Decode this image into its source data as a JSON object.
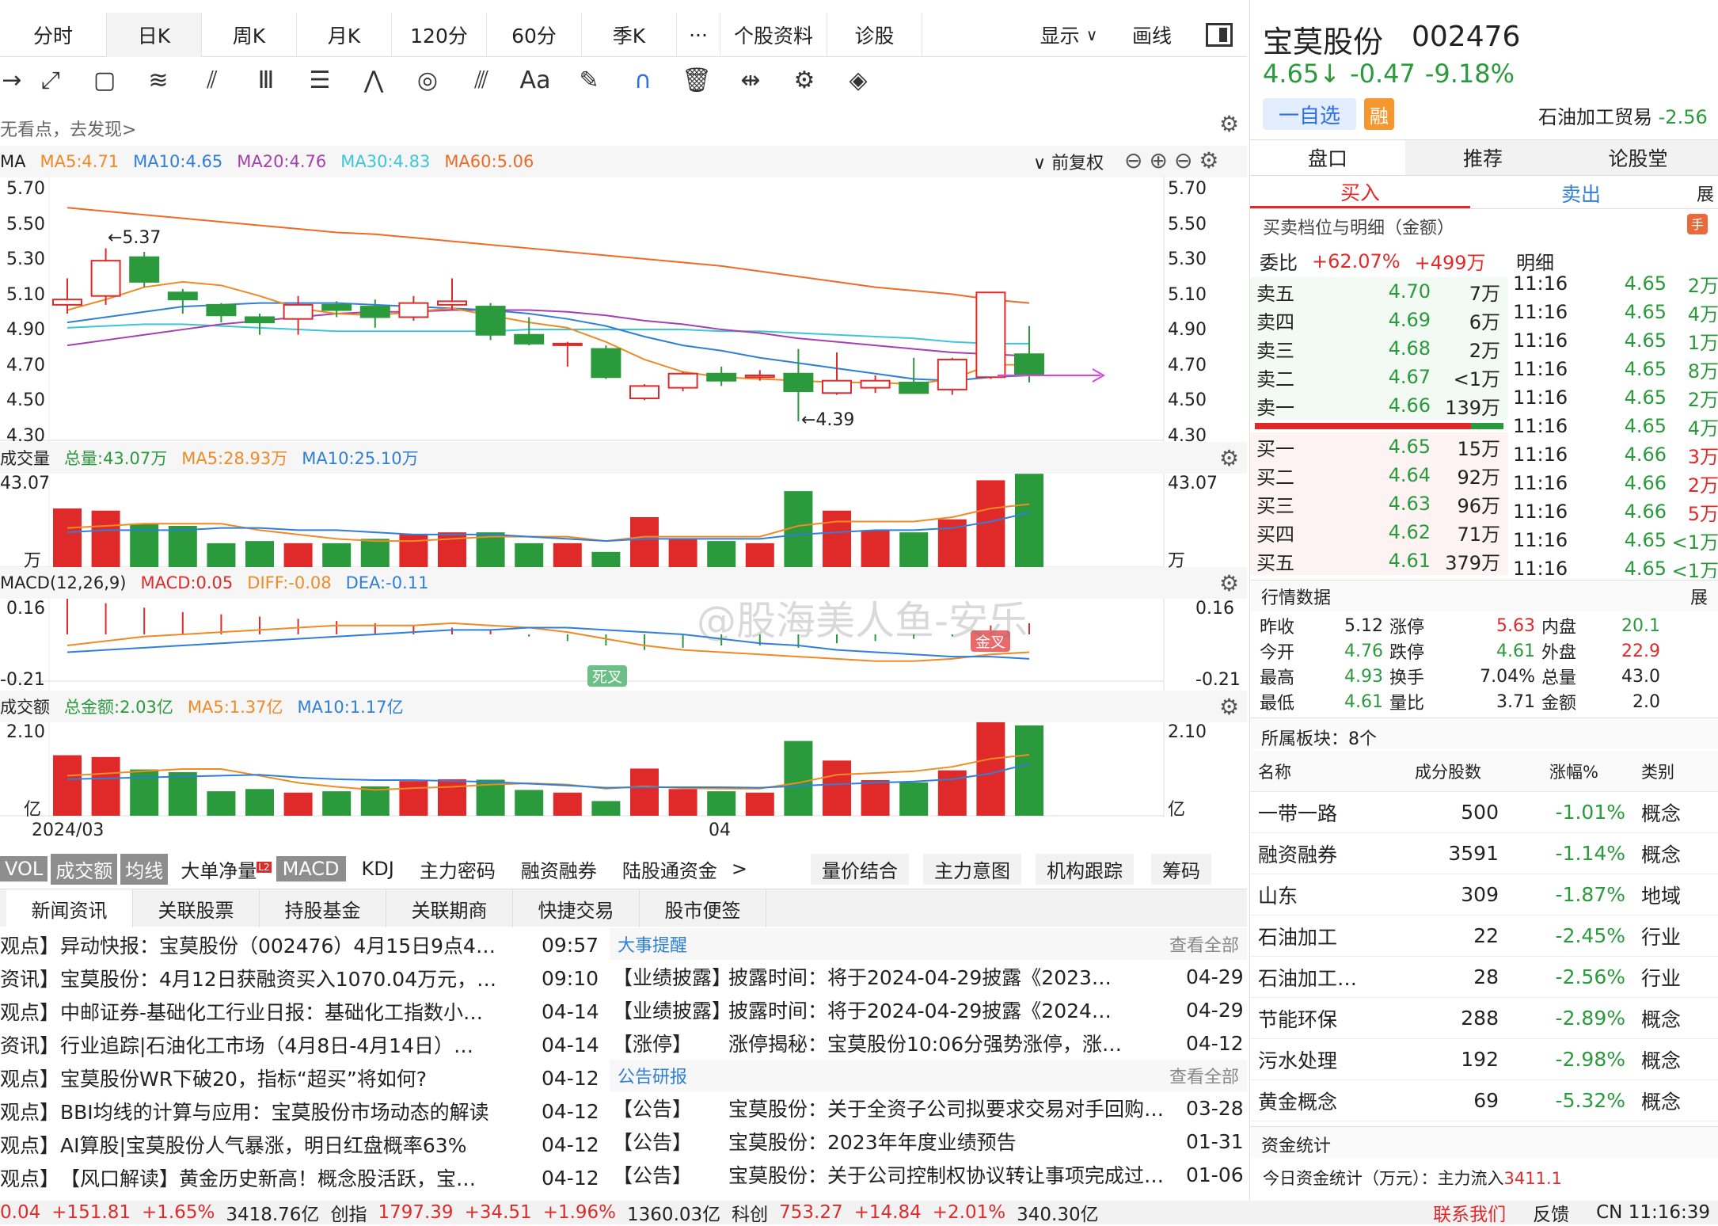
{
  "top_tabs": [
    "分时",
    "日K",
    "周K",
    "月K",
    "120分",
    "60分",
    "季K",
    "···",
    "个股资料",
    "诊股"
  ],
  "top_right": {
    "display": "显示",
    "draw": "画线"
  },
  "tip_text": "无看点，去发现>",
  "ma_bar": {
    "label": "MA",
    "ma5": "MA5:4.71",
    "ma10": "MA10:4.65",
    "ma20": "MA20:4.76",
    "ma30": "MA30:4.83",
    "ma60": "MA60:5.06",
    "adjust": "前复权"
  },
  "price_axis": [
    "5.70",
    "5.50",
    "5.30",
    "5.10",
    "4.90",
    "4.70",
    "4.50",
    "4.30"
  ],
  "high_mark": "←5.37",
  "low_mark": "←4.39",
  "vol_bar": {
    "label": "成交量",
    "total": "总量:43.07万",
    "ma5": "MA5:28.93万",
    "ma10": "MA10:25.10万"
  },
  "vol_axis": {
    "top": "43.07",
    "unit": "万"
  },
  "macd_bar": {
    "label": "MACD(12,26,9)",
    "macd": "MACD:0.05",
    "diff": "DIFF:-0.08",
    "dea": "DEA:-0.11"
  },
  "macd_axis": {
    "top": "0.16",
    "bottom": "-0.21"
  },
  "macd_marks": {
    "dead": "死叉",
    "golden": "金叉"
  },
  "amt_bar": {
    "label": "成交额",
    "total": "总金额:2.03亿",
    "ma5": "MA5:1.37亿",
    "ma10": "MA10:1.17亿"
  },
  "amt_axis": {
    "top": "2.10",
    "unit": "亿"
  },
  "dates": [
    "2024/03",
    "04"
  ],
  "watermark": "@股海美人鱼-安乐",
  "indicator_tabs": [
    "VOL",
    "成交额",
    "均线",
    "大单净量",
    "MACD",
    "KDJ",
    "主力密码",
    "融资融券",
    "陆股通资金",
    ">"
  ],
  "indicator_badge": "L2",
  "right_tabs": [
    "量价结合",
    "主力意图",
    "机构跟踪",
    "筹码"
  ],
  "news_tabs": [
    "新闻资讯",
    "关联股票",
    "持股基金",
    "关联期商",
    "快捷交易",
    "股市便签"
  ],
  "news": [
    {
      "tag": "观点】",
      "title": "异动快报：宝莫股份（002476）4月15日9点4…",
      "time": "09:57"
    },
    {
      "tag": "资讯】",
      "title": "宝莫股份：4月12日获融资买入1070.04万元，…",
      "time": "09:10"
    },
    {
      "tag": "观点】",
      "title": "中邮证券-基础化工行业日报：基础化工指数小…",
      "time": "04-14"
    },
    {
      "tag": "资讯】",
      "title": "行业追踪|石油化工市场（4月8日-4月14日）…",
      "time": "04-14"
    },
    {
      "tag": "观点】",
      "title": "宝莫股份WR下破20，指标“超买”将如何?",
      "time": "04-12"
    },
    {
      "tag": "观点】",
      "title": "BBI均线的计算与应用：宝莫股份市场动态的解读",
      "time": "04-12"
    },
    {
      "tag": "观点】",
      "title": "AI算股|宝莫股份人气暴涨，明日红盘概率63%",
      "time": "04-12"
    },
    {
      "tag": "观点】",
      "title": "【风口解读】黄金历史新高！概念股活跃，宝…",
      "time": "04-12"
    }
  ],
  "events_title": "大事提醒",
  "view_all": "查看全部",
  "events": [
    {
      "tag": "【业绩披露】",
      "title": "披露时间：将于2024-04-29披露《2023…",
      "time": "04-29"
    },
    {
      "tag": "【业绩披露】",
      "title": "披露时间：将于2024-04-29披露《2024…",
      "time": "04-29"
    },
    {
      "tag": "【涨停】",
      "title": "涨停揭秘：宝莫股份10:06分强势涨停，涨…",
      "time": "04-12"
    }
  ],
  "notice_title": "公告研报",
  "notices": [
    {
      "tag": "【公告】",
      "title": "宝莫股份：关于全资子公司拟要求交易对手回购…",
      "time": "03-28"
    },
    {
      "tag": "【公告】",
      "title": "宝莫股份：2023年年度业绩预告",
      "time": "01-31"
    },
    {
      "tag": "【公告】",
      "title": "宝莫股份：关于公司控制权协议转让事项完成过…",
      "time": "01-06"
    }
  ],
  "stock": {
    "name": "宝莫股份",
    "code": "002476",
    "price": "4.65↓",
    "chg": "-0.47",
    "pct": "-9.18%",
    "watch": "一自选",
    "margin": "融",
    "sector": "石油加工贸易",
    "sector_pct": "-2.56"
  },
  "quote_tabs": [
    "盘口",
    "推荐",
    "论股堂"
  ],
  "buy_sell_tabs": [
    "买入",
    "卖出",
    "展"
  ],
  "order_title": "买卖档位与明细（金额）",
  "weibi": {
    "label": "委比",
    "pct": "+62.07%",
    "amt": "+499万",
    "detail": "明细"
  },
  "asks": [
    {
      "l": "卖五",
      "p": "4.70",
      "v": "7万"
    },
    {
      "l": "卖四",
      "p": "4.69",
      "v": "6万"
    },
    {
      "l": "卖三",
      "p": "4.68",
      "v": "2万"
    },
    {
      "l": "卖二",
      "p": "4.67",
      "v": "<1万"
    },
    {
      "l": "卖一",
      "p": "4.66",
      "v": "139万"
    }
  ],
  "bids": [
    {
      "l": "买一",
      "p": "4.65",
      "v": "15万"
    },
    {
      "l": "买二",
      "p": "4.64",
      "v": "92万"
    },
    {
      "l": "买三",
      "p": "4.63",
      "v": "96万"
    },
    {
      "l": "买四",
      "p": "4.62",
      "v": "71万"
    },
    {
      "l": "买五",
      "p": "4.61",
      "v": "379万"
    }
  ],
  "ticks": [
    {
      "t": "11:16",
      "p": "4.65",
      "v": "2万"
    },
    {
      "t": "11:16",
      "p": "4.65",
      "v": "4万"
    },
    {
      "t": "11:16",
      "p": "4.65",
      "v": "1万"
    },
    {
      "t": "11:16",
      "p": "4.65",
      "v": "8万"
    },
    {
      "t": "11:16",
      "p": "4.65",
      "v": "2万"
    },
    {
      "t": "11:16",
      "p": "4.65",
      "v": "4万"
    },
    {
      "t": "11:16",
      "p": "4.66",
      "v": "3万"
    },
    {
      "t": "11:16",
      "p": "4.66",
      "v": "2万"
    },
    {
      "t": "11:16",
      "p": "4.66",
      "v": "5万"
    },
    {
      "t": "11:16",
      "p": "4.65",
      "v": "<1万"
    },
    {
      "t": "11:16",
      "p": "4.65",
      "v": "<1万"
    }
  ],
  "mkt_title": "行情数据",
  "mkt_more": "展",
  "mkt": [
    [
      "昨收",
      "5.12",
      "涨停",
      "5.63",
      "内盘",
      "20.1"
    ],
    [
      "今开",
      "4.76",
      "跌停",
      "4.61",
      "外盘",
      "22.9"
    ],
    [
      "最高",
      "4.93",
      "换手",
      "7.04%",
      "总量",
      "43.0"
    ],
    [
      "最低",
      "4.61",
      "量比",
      "3.71",
      "金额",
      "2.0"
    ]
  ],
  "sector_title": "所属板块：8个",
  "sector_head": [
    "名称",
    "成分股数",
    "涨幅%",
    "类别"
  ],
  "sectors": [
    [
      "一带一路",
      "500",
      "-1.01%",
      "概念"
    ],
    [
      "融资融券",
      "3591",
      "-1.14%",
      "概念"
    ],
    [
      "山东",
      "309",
      "-1.87%",
      "地域"
    ],
    [
      "石油加工",
      "22",
      "-2.45%",
      "行业"
    ],
    [
      "石油加工…",
      "28",
      "-2.56%",
      "行业"
    ],
    [
      "节能环保",
      "288",
      "-2.89%",
      "概念"
    ],
    [
      "污水处理",
      "192",
      "-2.98%",
      "概念"
    ],
    [
      "黄金概念",
      "69",
      "-5.32%",
      "概念"
    ]
  ],
  "fund_title": "资金统计",
  "fund_text": "今日资金统计（万元）：主力流入",
  "fund_val": "3411.1",
  "bottom": {
    "a": "0.04",
    "b": "+151.81",
    "c": "+1.65%",
    "d": "3418.76亿",
    "e": "创指",
    "f": "1797.39",
    "g": "+34.51",
    "h": "+1.96%",
    "i": "1360.03亿",
    "j": "科创",
    "k": "753.27",
    "l": "+14.84",
    "m": "+2.01%",
    "n": "340.30亿",
    "contact": "联系我们",
    "feedback": "反馈",
    "time": "CN 11:16:39"
  },
  "chart_data": {
    "type": "candlestick",
    "ylim": [
      4.3,
      5.7
    ],
    "candles": [
      {
        "o": 5.05,
        "c": 5.08,
        "h": 5.2,
        "l": 5.0
      },
      {
        "o": 5.1,
        "c": 5.3,
        "h": 5.37,
        "l": 5.05
      },
      {
        "o": 5.32,
        "c": 5.18,
        "h": 5.35,
        "l": 5.15
      },
      {
        "o": 5.12,
        "c": 5.08,
        "h": 5.14,
        "l": 5.0
      },
      {
        "o": 5.05,
        "c": 4.99,
        "h": 5.06,
        "l": 4.95
      },
      {
        "o": 4.98,
        "c": 4.95,
        "h": 5.0,
        "l": 4.88
      },
      {
        "o": 4.97,
        "c": 5.05,
        "h": 5.1,
        "l": 4.88
      },
      {
        "o": 5.05,
        "c": 5.02,
        "h": 5.07,
        "l": 4.98
      },
      {
        "o": 5.04,
        "c": 4.98,
        "h": 5.08,
        "l": 4.92
      },
      {
        "o": 4.98,
        "c": 5.06,
        "h": 5.1,
        "l": 4.96
      },
      {
        "o": 5.05,
        "c": 5.07,
        "h": 5.2,
        "l": 5.02
      },
      {
        "o": 5.04,
        "c": 4.88,
        "h": 5.06,
        "l": 4.85
      },
      {
        "o": 4.88,
        "c": 4.83,
        "h": 4.98,
        "l": 4.82
      },
      {
        "o": 4.83,
        "c": 4.83,
        "h": 4.84,
        "l": 4.7
      },
      {
        "o": 4.8,
        "c": 4.64,
        "h": 4.82,
        "l": 4.63
      },
      {
        "o": 4.52,
        "c": 4.59,
        "h": 4.6,
        "l": 4.51
      },
      {
        "o": 4.58,
        "c": 4.66,
        "h": 4.67,
        "l": 4.56
      },
      {
        "o": 4.66,
        "c": 4.62,
        "h": 4.7,
        "l": 4.59
      },
      {
        "o": 4.64,
        "c": 4.65,
        "h": 4.68,
        "l": 4.62
      },
      {
        "o": 4.66,
        "c": 4.56,
        "h": 4.8,
        "l": 4.39
      },
      {
        "o": 4.55,
        "c": 4.62,
        "h": 4.78,
        "l": 4.54
      },
      {
        "o": 4.58,
        "c": 4.62,
        "h": 4.65,
        "l": 4.55
      },
      {
        "o": 4.61,
        "c": 4.55,
        "h": 4.75,
        "l": 4.55
      },
      {
        "o": 4.57,
        "c": 4.74,
        "h": 4.75,
        "l": 4.54
      },
      {
        "o": 4.64,
        "c": 5.12,
        "h": 5.12,
        "l": 4.63
      },
      {
        "o": 4.77,
        "c": 4.65,
        "h": 4.93,
        "l": 4.61
      }
    ],
    "ma5": [
      5.02,
      5.08,
      5.15,
      5.18,
      5.16,
      5.1,
      5.03,
      5.0,
      4.99,
      5.01,
      5.03,
      4.99,
      4.95,
      4.92,
      4.84,
      4.74,
      4.67,
      4.64,
      4.63,
      4.62,
      4.61,
      4.61,
      4.6,
      4.63,
      4.71,
      4.71
    ],
    "ma10": [
      4.95,
      4.98,
      5.01,
      5.04,
      5.05,
      5.06,
      5.06,
      5.06,
      5.05,
      5.04,
      5.03,
      5.02,
      5.0,
      4.97,
      4.93,
      4.87,
      4.82,
      4.79,
      4.75,
      4.72,
      4.69,
      4.66,
      4.63,
      4.62,
      4.64,
      4.65
    ],
    "ma20": [
      4.82,
      4.85,
      4.88,
      4.91,
      4.94,
      4.96,
      4.98,
      5.0,
      5.01,
      5.01,
      5.02,
      5.02,
      5.02,
      5.01,
      4.99,
      4.96,
      4.94,
      4.91,
      4.89,
      4.86,
      4.84,
      4.82,
      4.8,
      4.78,
      4.77,
      4.76
    ],
    "ma30": [
      4.92,
      4.93,
      4.94,
      4.94,
      4.93,
      4.92,
      4.91,
      4.9,
      4.9,
      4.9,
      4.9,
      4.9,
      4.91,
      4.91,
      4.91,
      4.91,
      4.91,
      4.9,
      4.9,
      4.89,
      4.88,
      4.87,
      4.86,
      4.84,
      4.83,
      4.83
    ],
    "ma60": [
      5.6,
      5.58,
      5.56,
      5.54,
      5.52,
      5.5,
      5.48,
      5.46,
      5.45,
      5.43,
      5.41,
      5.39,
      5.37,
      5.35,
      5.33,
      5.31,
      5.29,
      5.27,
      5.24,
      5.21,
      5.18,
      5.15,
      5.13,
      5.11,
      5.08,
      5.06
    ],
    "volume": [
      27,
      26,
      20,
      19,
      11,
      12,
      11,
      11,
      13,
      15,
      16,
      16,
      11,
      11,
      7,
      23,
      13,
      12,
      11,
      35,
      26,
      17,
      16,
      22,
      40,
      43
    ],
    "vol_ma5": [
      18,
      19,
      20,
      20,
      20,
      17,
      15,
      13,
      12,
      12,
      13,
      14,
      14,
      14,
      12,
      14,
      14,
      14,
      14,
      19,
      21,
      21,
      21,
      23,
      27,
      29
    ],
    "vol_ma10": [
      16,
      17,
      17,
      17,
      18,
      18,
      17,
      17,
      16,
      15,
      15,
      15,
      14,
      13,
      12,
      13,
      13,
      13,
      13,
      15,
      16,
      17,
      17,
      18,
      21,
      25
    ],
    "amount": [
      1.36,
      1.32,
      1.04,
      0.98,
      0.55,
      0.6,
      0.52,
      0.55,
      0.66,
      0.78,
      0.82,
      0.81,
      0.58,
      0.52,
      0.33,
      1.06,
      0.6,
      0.55,
      0.52,
      1.68,
      1.24,
      0.8,
      0.75,
      1.02,
      2.1,
      2.03
    ],
    "amt_ma5": [
      0.9,
      0.95,
      1.0,
      1.05,
      1.05,
      0.9,
      0.74,
      0.65,
      0.58,
      0.62,
      0.65,
      0.7,
      0.73,
      0.7,
      0.61,
      0.66,
      0.62,
      0.61,
      0.61,
      0.74,
      0.92,
      0.96,
      1.0,
      1.1,
      1.28,
      1.37
    ],
    "amt_ma10": [
      0.82,
      0.84,
      0.86,
      0.88,
      0.9,
      0.92,
      0.86,
      0.82,
      0.8,
      0.8,
      0.78,
      0.76,
      0.72,
      0.68,
      0.63,
      0.64,
      0.64,
      0.64,
      0.63,
      0.67,
      0.71,
      0.74,
      0.77,
      0.82,
      0.95,
      1.17
    ],
    "macd": [
      0.16,
      0.14,
      0.12,
      0.1,
      0.09,
      0.08,
      0.07,
      0.06,
      0.05,
      0.04,
      0.03,
      0.02,
      -0.01,
      -0.03,
      -0.05,
      -0.07,
      -0.06,
      -0.05,
      -0.05,
      -0.06,
      -0.04,
      -0.03,
      -0.02,
      -0.01,
      0.04,
      0.05
    ],
    "diff": [
      -0.05,
      -0.03,
      -0.01,
      0.0,
      0.01,
      0.02,
      0.03,
      0.04,
      0.04,
      0.04,
      0.05,
      0.04,
      0.03,
      0.01,
      -0.02,
      -0.05,
      -0.07,
      -0.08,
      -0.09,
      -0.1,
      -0.11,
      -0.12,
      -0.12,
      -0.11,
      -0.09,
      -0.08
    ],
    "dea": [
      -0.08,
      -0.07,
      -0.06,
      -0.05,
      -0.04,
      -0.03,
      -0.02,
      -0.01,
      0.0,
      0.01,
      0.02,
      0.02,
      0.03,
      0.03,
      0.02,
      0.01,
      0.0,
      -0.02,
      -0.04,
      -0.05,
      -0.07,
      -0.08,
      -0.09,
      -0.1,
      -0.1,
      -0.11
    ],
    "macd_range": [
      -0.21,
      0.16
    ]
  },
  "colors": {
    "up": "#e02a2a",
    "down": "#2a9a3c",
    "ma5": "#f08a24",
    "ma10": "#2f7fd8",
    "ma20": "#a63fb0",
    "ma30": "#3cc6d6",
    "ma60": "#f06a24"
  }
}
